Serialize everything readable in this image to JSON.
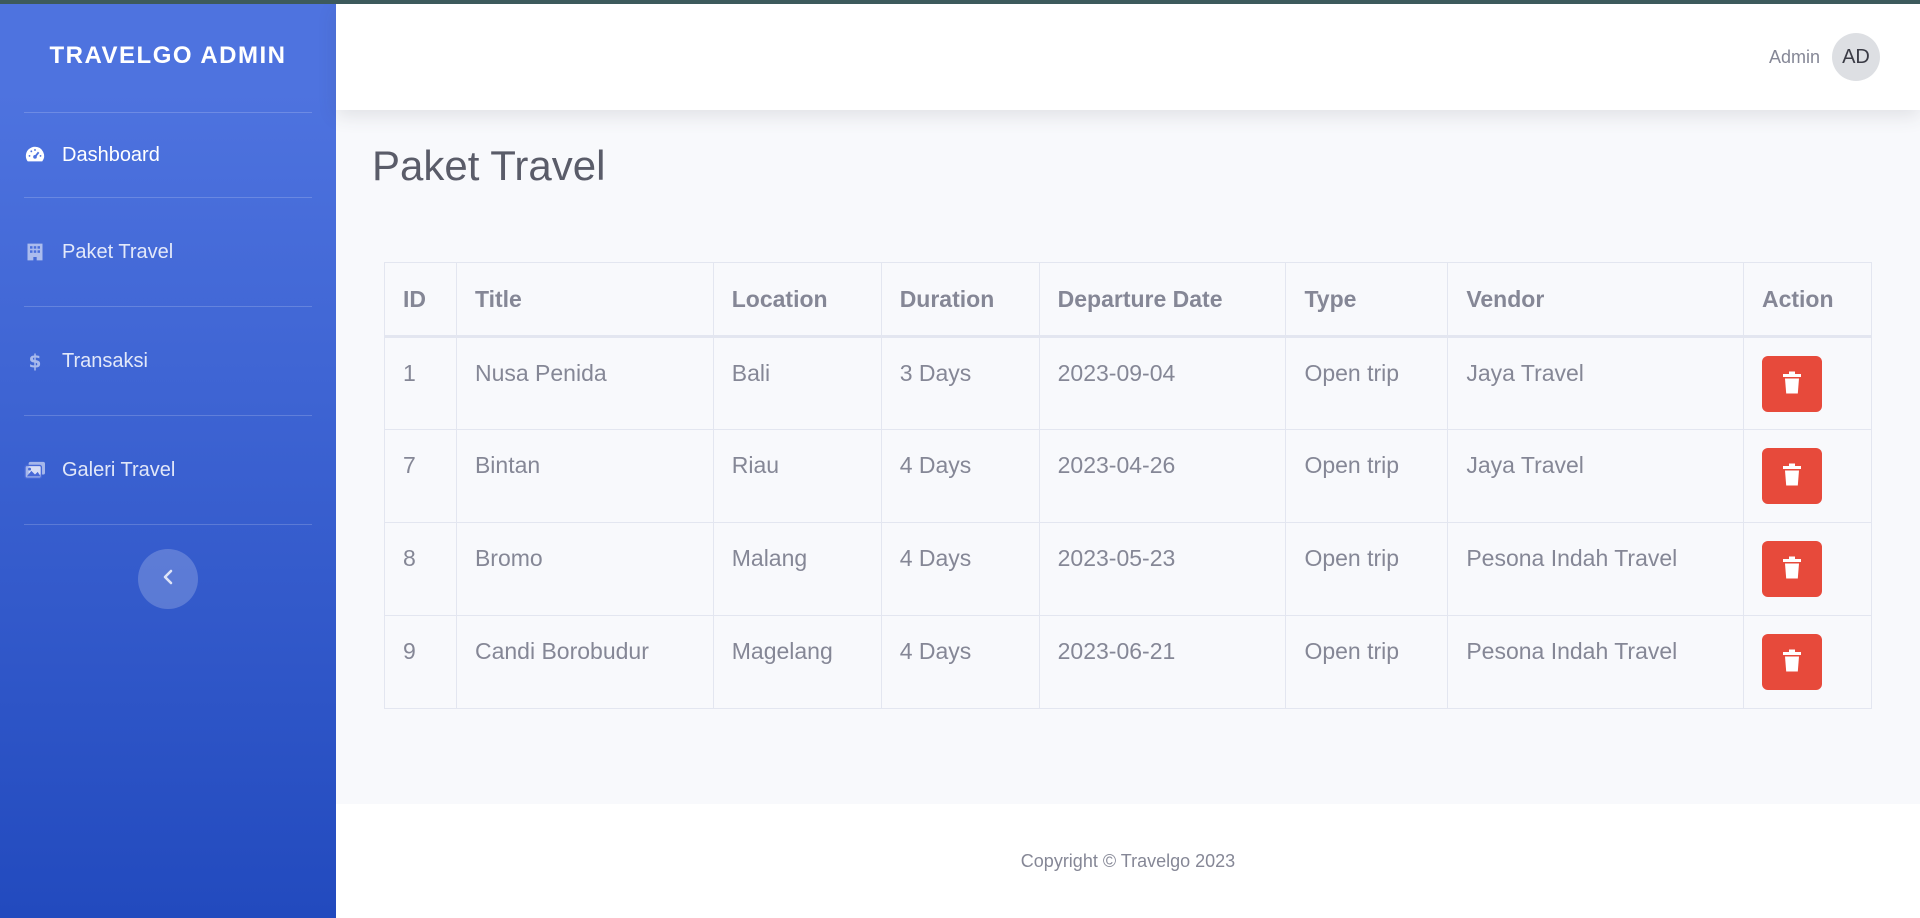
{
  "sidebar": {
    "brand": "TRAVELGO ADMIN",
    "items": [
      {
        "label": "Dashboard",
        "icon": "tachometer-icon"
      },
      {
        "label": "Paket Travel",
        "icon": "building-icon"
      },
      {
        "label": "Transaksi",
        "icon": "dollar-icon"
      },
      {
        "label": "Galeri Travel",
        "icon": "images-icon"
      }
    ],
    "toggle_icon": "chevron-left-icon"
  },
  "topbar": {
    "user_name": "Admin",
    "avatar_initials": "AD"
  },
  "page": {
    "title": "Paket Travel"
  },
  "table": {
    "headers": [
      "ID",
      "Title",
      "Location",
      "Duration",
      "Departure Date",
      "Type",
      "Vendor",
      "Action"
    ],
    "rows": [
      [
        "1",
        "Nusa Penida",
        "Bali",
        "3 Days",
        "2023-09-04",
        "Open trip",
        "Jaya Travel"
      ],
      [
        "7",
        "Bintan",
        "Riau",
        "4 Days",
        "2023-04-26",
        "Open trip",
        "Jaya Travel"
      ],
      [
        "8",
        "Bromo",
        "Malang",
        "4 Days",
        "2023-05-23",
        "Open trip",
        "Pesona Indah Travel"
      ],
      [
        "9",
        "Candi Borobudur",
        "Magelang",
        "4 Days",
        "2023-06-21",
        "Open trip",
        "Pesona Indah Travel"
      ]
    ],
    "delete_icon": "trash-icon"
  },
  "footer": {
    "text": "Copyright © Travelgo 2023"
  },
  "colors": {
    "primary": "#4e73df",
    "danger": "#e74a3b",
    "text": "#858796"
  }
}
